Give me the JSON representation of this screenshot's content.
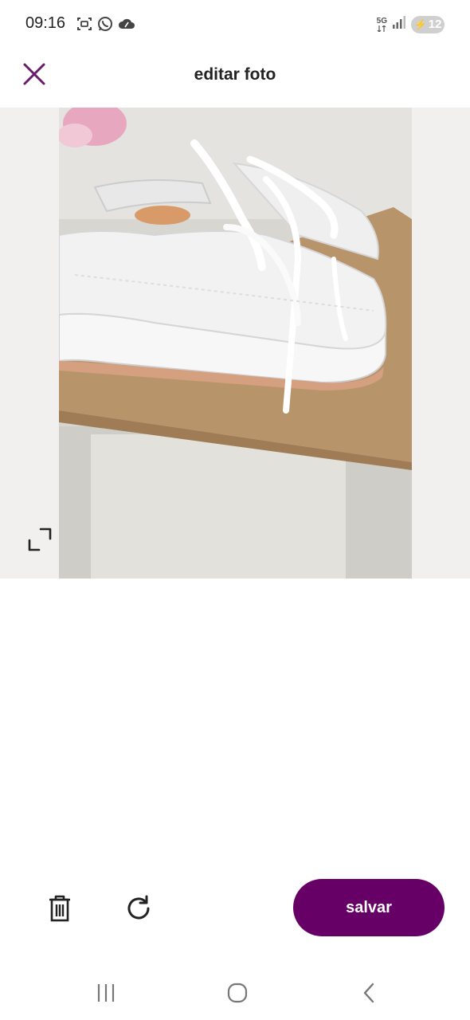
{
  "status_bar": {
    "time": "09:16",
    "network": "5G",
    "battery": "12",
    "left_icons": [
      "screenshot-icon",
      "whatsapp-icon",
      "cloud-icon"
    ],
    "right_icons": [
      "network-5g-icon",
      "signal-icon",
      "battery-icon"
    ]
  },
  "header": {
    "title": "editar foto",
    "close_icon": "close-icon"
  },
  "editor": {
    "photo_icon": "photo-preview",
    "expand_icon": "expand-icon"
  },
  "toolbar": {
    "delete_icon": "trash-icon",
    "rotate_icon": "rotate-icon",
    "save_label": "salvar"
  },
  "nav": {
    "items": [
      "recent-apps-icon",
      "home-icon",
      "back-icon"
    ]
  },
  "colors": {
    "accent": "#660066",
    "close_icon": "#6a1b6a",
    "text": "#222222",
    "editor_background": "#f1f0ee"
  }
}
